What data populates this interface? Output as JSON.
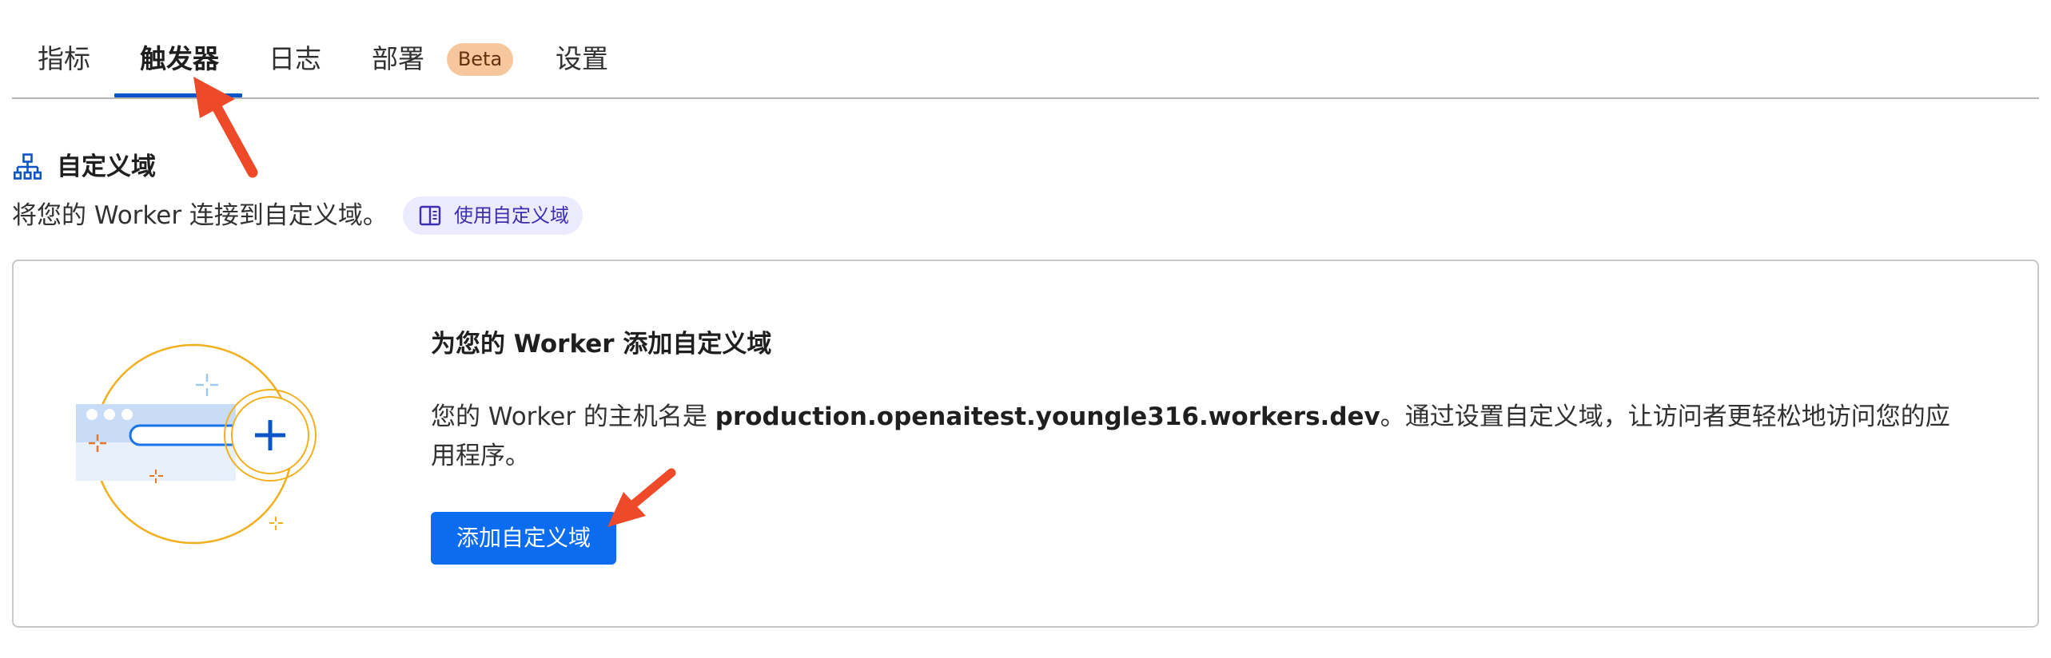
{
  "tabs": [
    {
      "label": "指标",
      "active": false
    },
    {
      "label": "触发器",
      "active": true
    },
    {
      "label": "日志",
      "active": false
    },
    {
      "label": "部署",
      "active": false,
      "badge": "Beta"
    },
    {
      "label": "设置",
      "active": false
    }
  ],
  "section": {
    "icon": "sitemap-icon",
    "title": "自定义域",
    "description": "将您的 Worker 连接到自定义域。",
    "doc_link": {
      "icon": "book-icon",
      "label": "使用自定义域"
    }
  },
  "card": {
    "illustration": "browser-add-domain-illustration",
    "title": "为您的 Worker 添加自定义域",
    "body_prefix": "您的 Worker 的主机名是 ",
    "hostname": "production.openaitest.youngle316.workers.dev",
    "body_suffix": "。通过设置自定义域，让访问者更轻松地访问您的应用程序。",
    "button_label": "添加自定义域"
  },
  "colors": {
    "accent": "#0b6cf0",
    "tab_underline": "#0b55c6",
    "beta_badge_bg": "#f6c79c",
    "doc_link_bg": "#eceafd",
    "annotation_arrow": "#ee4a2a"
  }
}
